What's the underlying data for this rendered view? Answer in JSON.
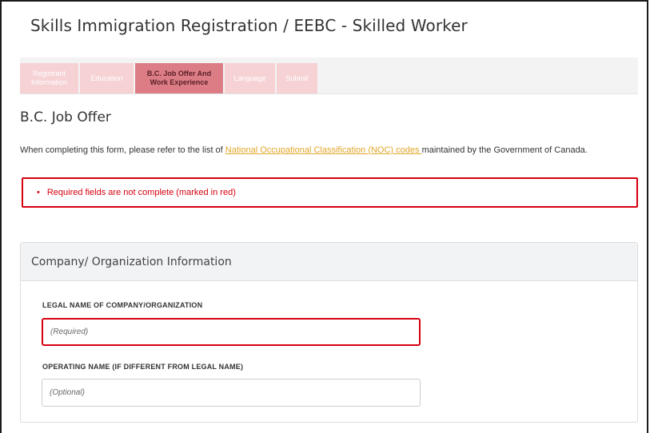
{
  "page": {
    "title": "Skills Immigration Registration / EEBC - Skilled Worker"
  },
  "steps": [
    {
      "label": "Registrant Information",
      "active": false
    },
    {
      "label": "Education",
      "active": false
    },
    {
      "label": "B.C. Job Offer And Work Experience",
      "active": true
    },
    {
      "label": "Language",
      "active": false
    },
    {
      "label": "Submit",
      "active": false
    }
  ],
  "section": {
    "title": "B.C. Job Offer",
    "intro_before": "When completing this form, please refer to the list of ",
    "intro_link": "National Occupational Classification (NOC) codes ",
    "intro_after": "maintained by the Government of Canada."
  },
  "error": {
    "bullet": "•",
    "message": "Required fields are not complete (marked in red)"
  },
  "panel": {
    "title": "Company/ Organization Information",
    "fields": [
      {
        "label": "LEGAL NAME OF COMPANY/ORGANIZATION",
        "placeholder": "(Required)",
        "value": "",
        "required": true
      },
      {
        "label": "OPERATING NAME (IF DIFFERENT FROM LEGAL NAME)",
        "placeholder": "(Optional)",
        "value": "",
        "required": false
      }
    ]
  },
  "colors": {
    "step_inactive": "#f6d2d5",
    "step_active": "#dc7d86",
    "error_red": "#d7000f",
    "link": "#e0a526"
  }
}
